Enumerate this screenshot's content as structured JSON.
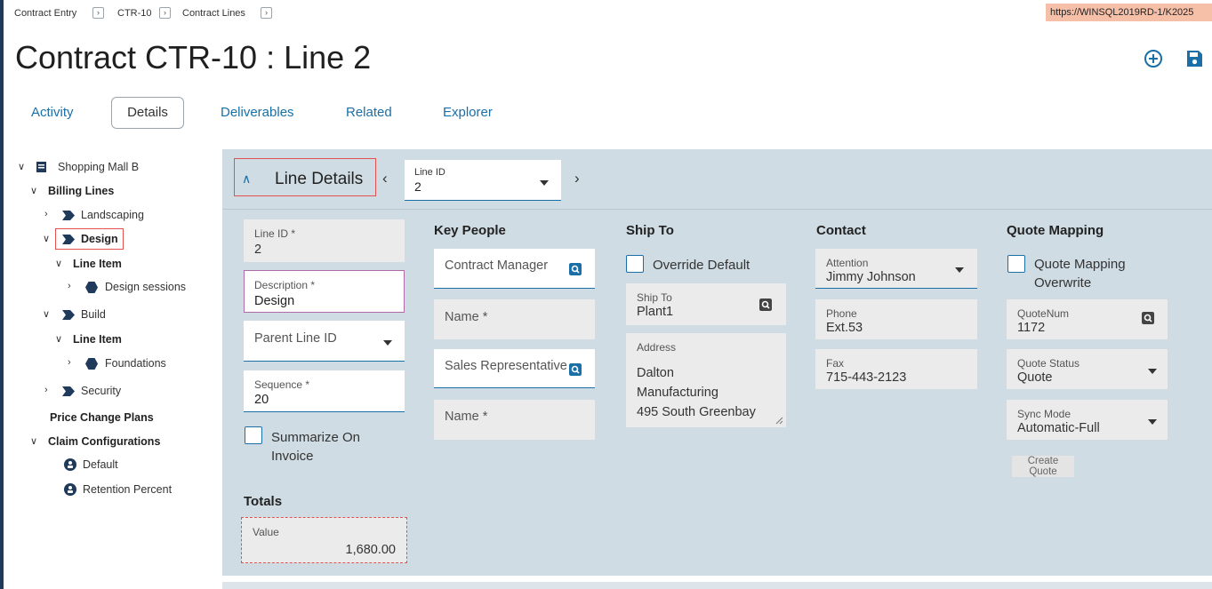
{
  "breadcrumb": [
    {
      "label": "Contract Entry"
    },
    {
      "label": "CTR-10"
    },
    {
      "label": "Contract Lines"
    }
  ],
  "url": "https://WINSQL2019RD-1/K2025",
  "title": "Contract CTR-10 : Line 2",
  "header_icons": {
    "add": "plus-circle-icon",
    "save": "save-icon"
  },
  "tabs": [
    {
      "label": "Activity"
    },
    {
      "label": "Details"
    },
    {
      "label": "Deliverables"
    },
    {
      "label": "Related"
    },
    {
      "label": "Explorer"
    }
  ],
  "tree": {
    "root": "Shopping Mall B",
    "billing_lines": "Billing Lines",
    "landscaping": "Landscaping",
    "design": "Design",
    "line_item_1": "Line Item",
    "design_sessions": "Design sessions",
    "build": "Build",
    "line_item_2": "Line Item",
    "foundations": "Foundations",
    "security": "Security",
    "price_change_plans": "Price Change Plans",
    "claim_configurations": "Claim Configurations",
    "default": "Default",
    "retention_percent": "Retention Percent"
  },
  "section": {
    "title": "Line Details",
    "line_id_select": {
      "label": "Line ID",
      "value": "2"
    }
  },
  "line": {
    "line_id": {
      "label": "Line ID *",
      "value": "2"
    },
    "description": {
      "label": "Description *",
      "value": "Design"
    },
    "parent_line_id": {
      "placeholder": "Parent Line ID"
    },
    "sequence": {
      "label": "Sequence *",
      "value": "20"
    },
    "summarize_on_invoice": {
      "label_1": "Summarize On",
      "label_2": "Invoice",
      "checked": false
    },
    "totals_heading": "Totals",
    "value": {
      "label": "Value",
      "value": "1,680.00"
    }
  },
  "key_people": {
    "heading": "Key People",
    "contract_manager": "Contract Manager",
    "name_1": "Name *",
    "sales_representative": "Sales Representative",
    "name_2": "Name *"
  },
  "ship_to": {
    "heading": "Ship To",
    "override_default": "Override Default",
    "override_checked": false,
    "ship_to_label": "Ship To",
    "ship_to_value": "Plant1",
    "address_label": "Address",
    "address_lines": [
      "Dalton",
      "Manufacturing",
      "495 South Greenbay"
    ]
  },
  "contact": {
    "heading": "Contact",
    "attention_label": "Attention",
    "attention_value": "Jimmy Johnson",
    "phone_label": "Phone",
    "phone_value": "Ext.53",
    "fax_label": "Fax",
    "fax_value": "715-443-2123"
  },
  "quote_mapping": {
    "heading": "Quote Mapping",
    "overwrite_label_1": "Quote Mapping",
    "overwrite_label_2": "Overwrite",
    "overwrite_checked": false,
    "quotenum_label": "QuoteNum",
    "quotenum_value": "1172",
    "quote_status_label": "Quote Status",
    "quote_status_value": "Quote",
    "sync_mode_label": "Sync Mode",
    "sync_mode_value": "Automatic-Full",
    "create_quote_1": "Create",
    "create_quote_2": "Quote"
  },
  "colors": {
    "accent": "#1a6fa7",
    "highlight_border": "#e25050",
    "panel_bg": "#cfdce3",
    "url_badge": "#f6bfa8"
  }
}
